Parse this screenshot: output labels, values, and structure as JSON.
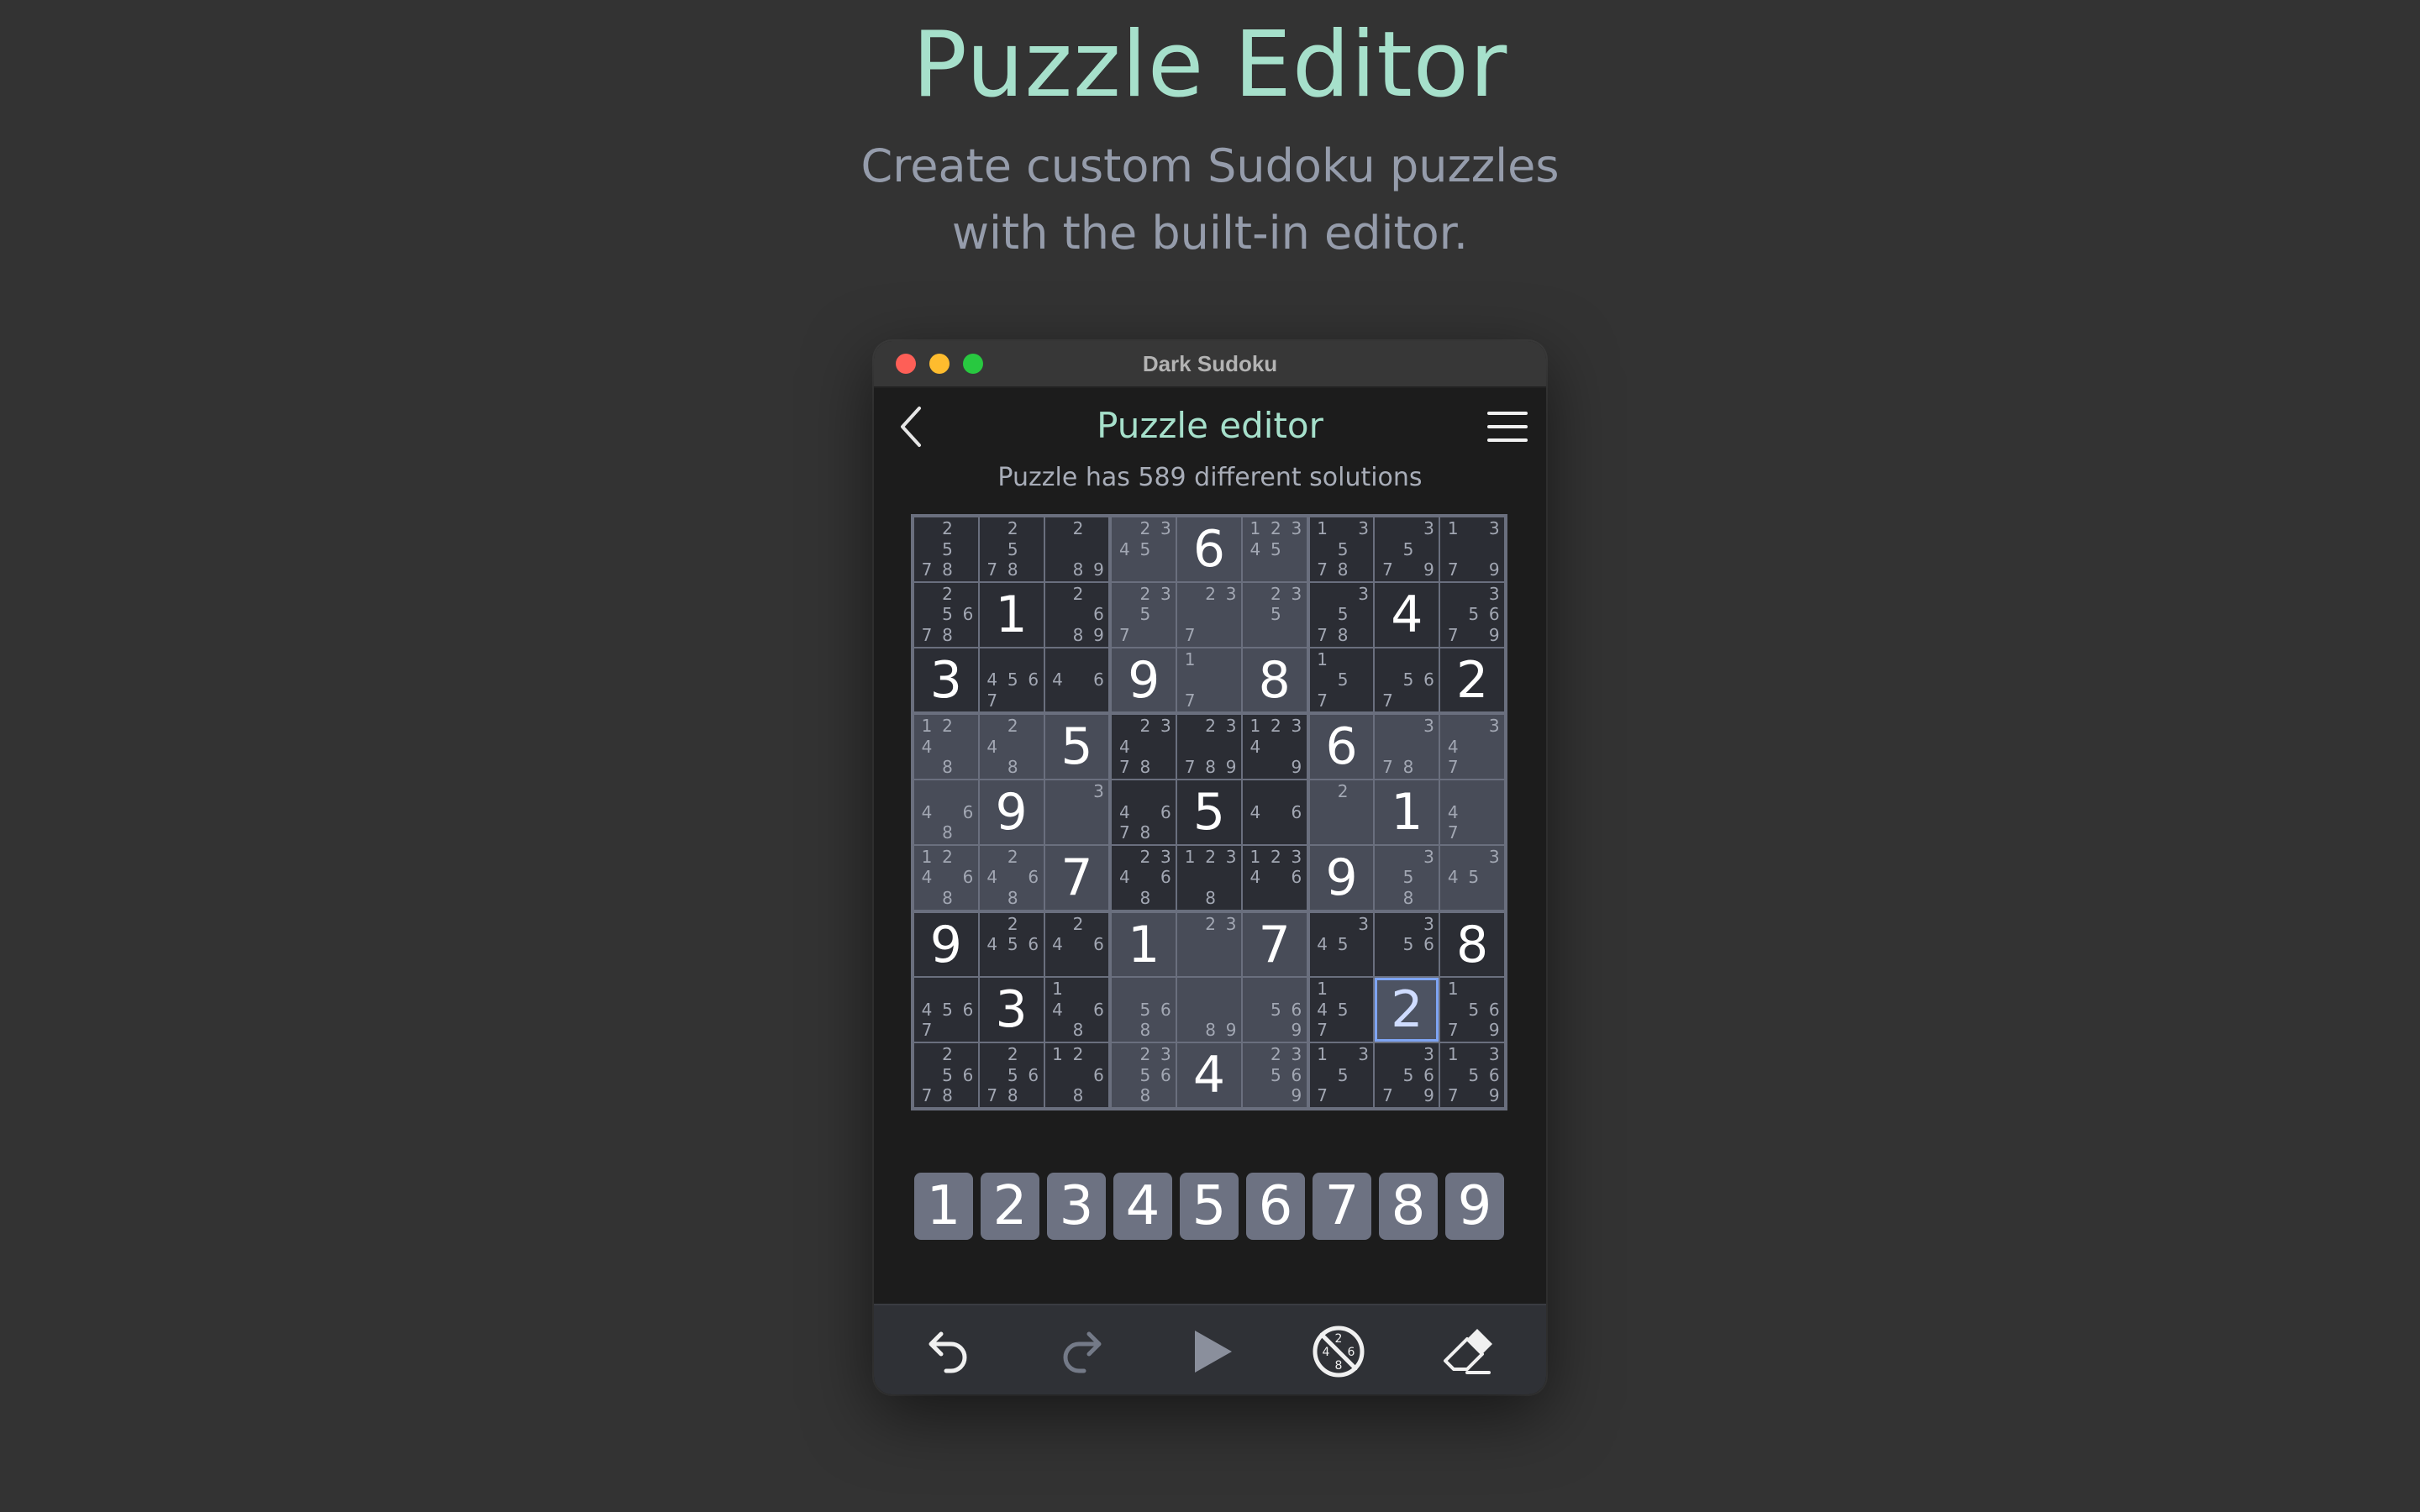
{
  "promo": {
    "title": "Puzzle Editor",
    "subtitle_line1": "Create custom Sudoku puzzles",
    "subtitle_line2": "with the built-in editor."
  },
  "window": {
    "title": "Dark Sudoku"
  },
  "app": {
    "title": "Puzzle editor",
    "status": "Puzzle has 589 different solutions",
    "accent_color": "#a6e0cb",
    "selection_color": "#7ea4f3"
  },
  "board": {
    "selected": [
      7,
      7
    ],
    "cells": [
      [
        [
          2,
          5,
          7,
          8
        ],
        [
          2,
          5,
          7,
          8
        ],
        [
          2,
          8,
          9
        ],
        [
          2,
          3,
          4,
          5
        ],
        6,
        [
          1,
          2,
          3,
          4,
          5
        ],
        [
          1,
          3,
          5,
          7,
          8
        ],
        [
          3,
          5,
          7,
          9
        ],
        [
          1,
          3,
          7,
          9
        ]
      ],
      [
        [
          2,
          5,
          6,
          7,
          8
        ],
        1,
        [
          2,
          6,
          8,
          9
        ],
        [
          2,
          3,
          5,
          7
        ],
        [
          2,
          3,
          7
        ],
        [
          2,
          3,
          5
        ],
        [
          3,
          5,
          7,
          8
        ],
        4,
        [
          3,
          5,
          6,
          7,
          9
        ]
      ],
      [
        3,
        [
          4,
          5,
          6,
          7
        ],
        [
          4,
          6
        ],
        9,
        [
          1,
          7
        ],
        8,
        [
          1,
          5,
          7
        ],
        [
          5,
          6,
          7
        ],
        2
      ],
      [
        [
          1,
          2,
          4,
          8
        ],
        [
          2,
          4,
          8
        ],
        5,
        [
          2,
          3,
          4,
          7,
          8
        ],
        [
          2,
          3,
          7,
          8,
          9
        ],
        [
          1,
          2,
          3,
          4,
          9
        ],
        6,
        [
          3,
          7,
          8
        ],
        [
          3,
          4,
          7
        ]
      ],
      [
        [
          4,
          6,
          8
        ],
        9,
        [
          3
        ],
        [
          4,
          6,
          7,
          8
        ],
        5,
        [
          4,
          6
        ],
        [
          2
        ],
        1,
        [
          4,
          7
        ]
      ],
      [
        [
          1,
          2,
          4,
          6,
          8
        ],
        [
          2,
          4,
          6,
          8
        ],
        7,
        [
          2,
          3,
          4,
          6,
          8
        ],
        [
          1,
          2,
          3,
          8
        ],
        [
          1,
          2,
          3,
          4,
          6
        ],
        9,
        [
          3,
          5,
          8
        ],
        [
          3,
          4,
          5
        ]
      ],
      [
        9,
        [
          2,
          4,
          5,
          6
        ],
        [
          2,
          4,
          6
        ],
        1,
        [
          2,
          3
        ],
        7,
        [
          3,
          4,
          5
        ],
        [
          3,
          5,
          6
        ],
        8
      ],
      [
        [
          4,
          5,
          6,
          7
        ],
        3,
        [
          1,
          4,
          6,
          8
        ],
        [
          5,
          6,
          8
        ],
        [
          8,
          9
        ],
        [
          5,
          6,
          9
        ],
        [
          1,
          4,
          5,
          7
        ],
        2,
        [
          1,
          5,
          6,
          7,
          9
        ]
      ],
      [
        [
          2,
          5,
          6,
          7,
          8
        ],
        [
          2,
          5,
          6,
          7,
          8
        ],
        [
          1,
          2,
          6,
          8
        ],
        [
          2,
          3,
          5,
          6,
          8
        ],
        4,
        [
          2,
          3,
          5,
          6,
          9
        ],
        [
          1,
          3,
          5,
          7
        ],
        [
          3,
          5,
          6,
          7,
          9
        ],
        [
          1,
          3,
          5,
          6,
          7,
          9
        ]
      ]
    ]
  },
  "numpad": [
    "1",
    "2",
    "3",
    "4",
    "5",
    "6",
    "7",
    "8",
    "9"
  ],
  "toolbar": {
    "undo_icon": "undo-icon",
    "redo_icon": "redo-icon",
    "play_icon": "play-icon",
    "toggle_candidates_icon": "no-candidates-icon",
    "eraser_icon": "eraser-icon"
  }
}
